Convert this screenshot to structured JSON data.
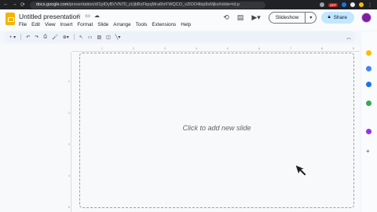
{
  "browser": {
    "url_domain": "docs.google.com",
    "url_path": "/presentation/d/1pIDyBVVN70_zUjbBzFkpqMra6hrFWQCO_vZlOO4bip8sMjks#slide=id.p",
    "nav_back": "←",
    "nav_forward": "→",
    "nav_reload": "⟳",
    "ext_badge": "APP"
  },
  "doc": {
    "title": "Untitled presentation"
  },
  "menu": [
    "File",
    "Edit",
    "View",
    "Insert",
    "Format",
    "Slide",
    "Arrange",
    "Tools",
    "Extensions",
    "Help"
  ],
  "header": {
    "slideshow_label": "Slideshow",
    "share_label": "Share"
  },
  "toolbar": {
    "icons": [
      "add-icon",
      "undo-icon",
      "redo-icon",
      "print-icon",
      "paint-format-icon",
      "zoom-icon",
      "select-icon",
      "textbox-icon",
      "image-icon",
      "shape-icon",
      "line-icon"
    ]
  },
  "ruler": {
    "h_ticks": [
      "1",
      "2",
      "3",
      "4",
      "5",
      "6",
      "7",
      "8",
      "9"
    ],
    "v_ticks": [
      "1",
      "2",
      "3",
      "4",
      "5"
    ]
  },
  "slide": {
    "placeholder": "Click to add new slide"
  },
  "colors": {
    "accent": "#0b57d0",
    "share_bg": "#c2e7ff",
    "logo_yellow": "#f4b400",
    "avatar": "#7b1fa2"
  }
}
